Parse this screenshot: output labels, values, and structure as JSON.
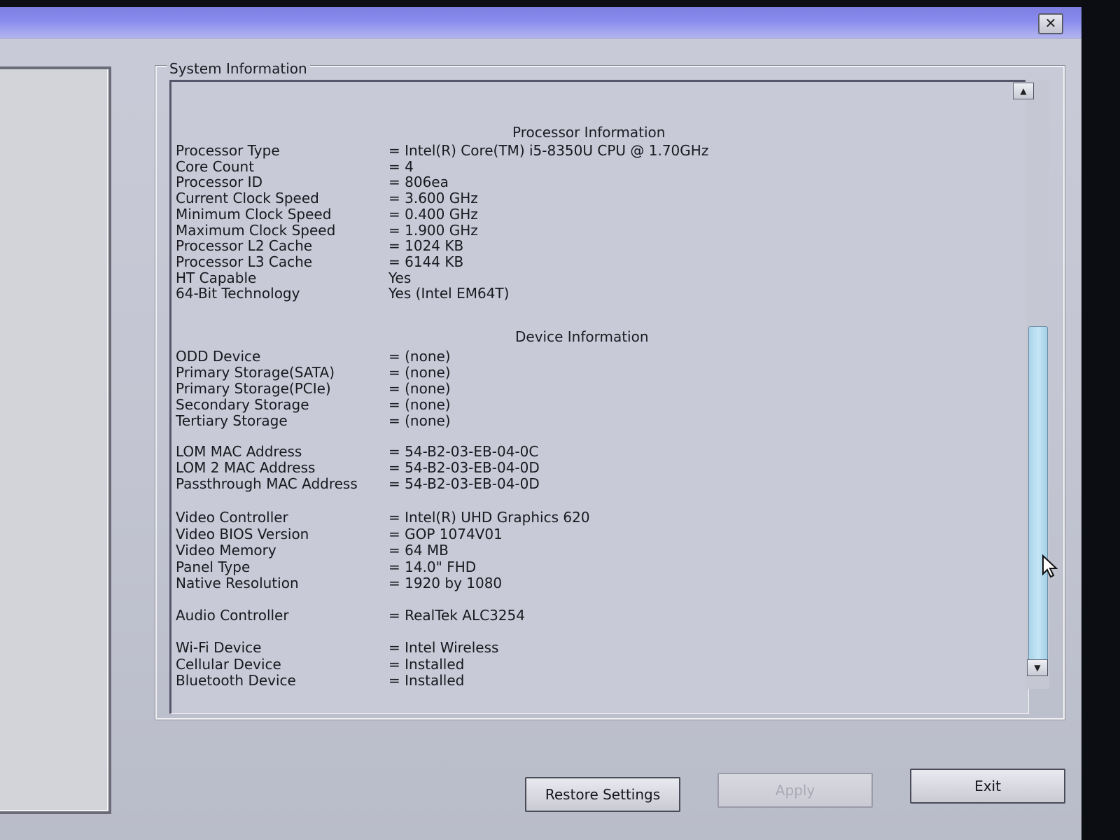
{
  "window": {
    "close_label": "✕"
  },
  "group_title": "System Information",
  "processor": {
    "header": "Processor Information",
    "rows": [
      {
        "label": "Processor Type",
        "value": "= Intel(R) Core(TM) i5-8350U CPU @ 1.70GHz"
      },
      {
        "label": "Core Count",
        "value": "= 4"
      },
      {
        "label": "Processor ID",
        "value": "= 806ea"
      },
      {
        "label": "Current Clock Speed",
        "value": "= 3.600 GHz"
      },
      {
        "label": "Minimum Clock Speed",
        "value": "= 0.400 GHz"
      },
      {
        "label": "Maximum Clock Speed",
        "value": "= 1.900 GHz"
      },
      {
        "label": "Processor L2 Cache",
        "value": "= 1024 KB"
      },
      {
        "label": "Processor L3 Cache",
        "value": "= 6144 KB"
      },
      {
        "label": "HT Capable",
        "value": "Yes"
      },
      {
        "label": "64-Bit Technology",
        "value": "Yes (Intel EM64T)"
      }
    ]
  },
  "device": {
    "header": "Device Information",
    "storage": [
      {
        "label": "ODD Device",
        "value": "= (none)"
      },
      {
        "label": "Primary Storage(SATA)",
        "value": "= (none)"
      },
      {
        "label": "Primary Storage(PCIe)",
        "value": "= (none)"
      },
      {
        "label": "Secondary Storage",
        "value": "= (none)"
      },
      {
        "label": "Tertiary Storage",
        "value": "= (none)"
      }
    ],
    "network": [
      {
        "label": "LOM MAC Address",
        "value": "= 54-B2-03-EB-04-0C"
      },
      {
        "label": "LOM 2 MAC Address",
        "value": "= 54-B2-03-EB-04-0D"
      },
      {
        "label": "Passthrough MAC Address",
        "value": "= 54-B2-03-EB-04-0D"
      }
    ],
    "video": [
      {
        "label": "Video Controller",
        "value": "= Intel(R) UHD Graphics 620"
      },
      {
        "label": "Video BIOS Version",
        "value": "= GOP 1074V01"
      },
      {
        "label": "Video Memory",
        "value": "= 64 MB"
      },
      {
        "label": "Panel Type",
        "value": "= 14.0\" FHD"
      },
      {
        "label": "Native Resolution",
        "value": "= 1920 by 1080"
      }
    ],
    "audio": [
      {
        "label": "Audio Controller",
        "value": "= RealTek ALC3254"
      }
    ],
    "wireless": [
      {
        "label": "Wi-Fi Device",
        "value": "= Intel Wireless"
      },
      {
        "label": "Cellular Device",
        "value": "= Installed"
      },
      {
        "label": "Bluetooth Device",
        "value": "= Installed"
      }
    ]
  },
  "scrollbar": {
    "up_icon": "chevron-up-icon",
    "down_icon": "chevron-down-icon",
    "position": 0.41
  },
  "buttons": {
    "restore": "Restore Settings",
    "apply": "Apply",
    "exit": "Exit"
  }
}
